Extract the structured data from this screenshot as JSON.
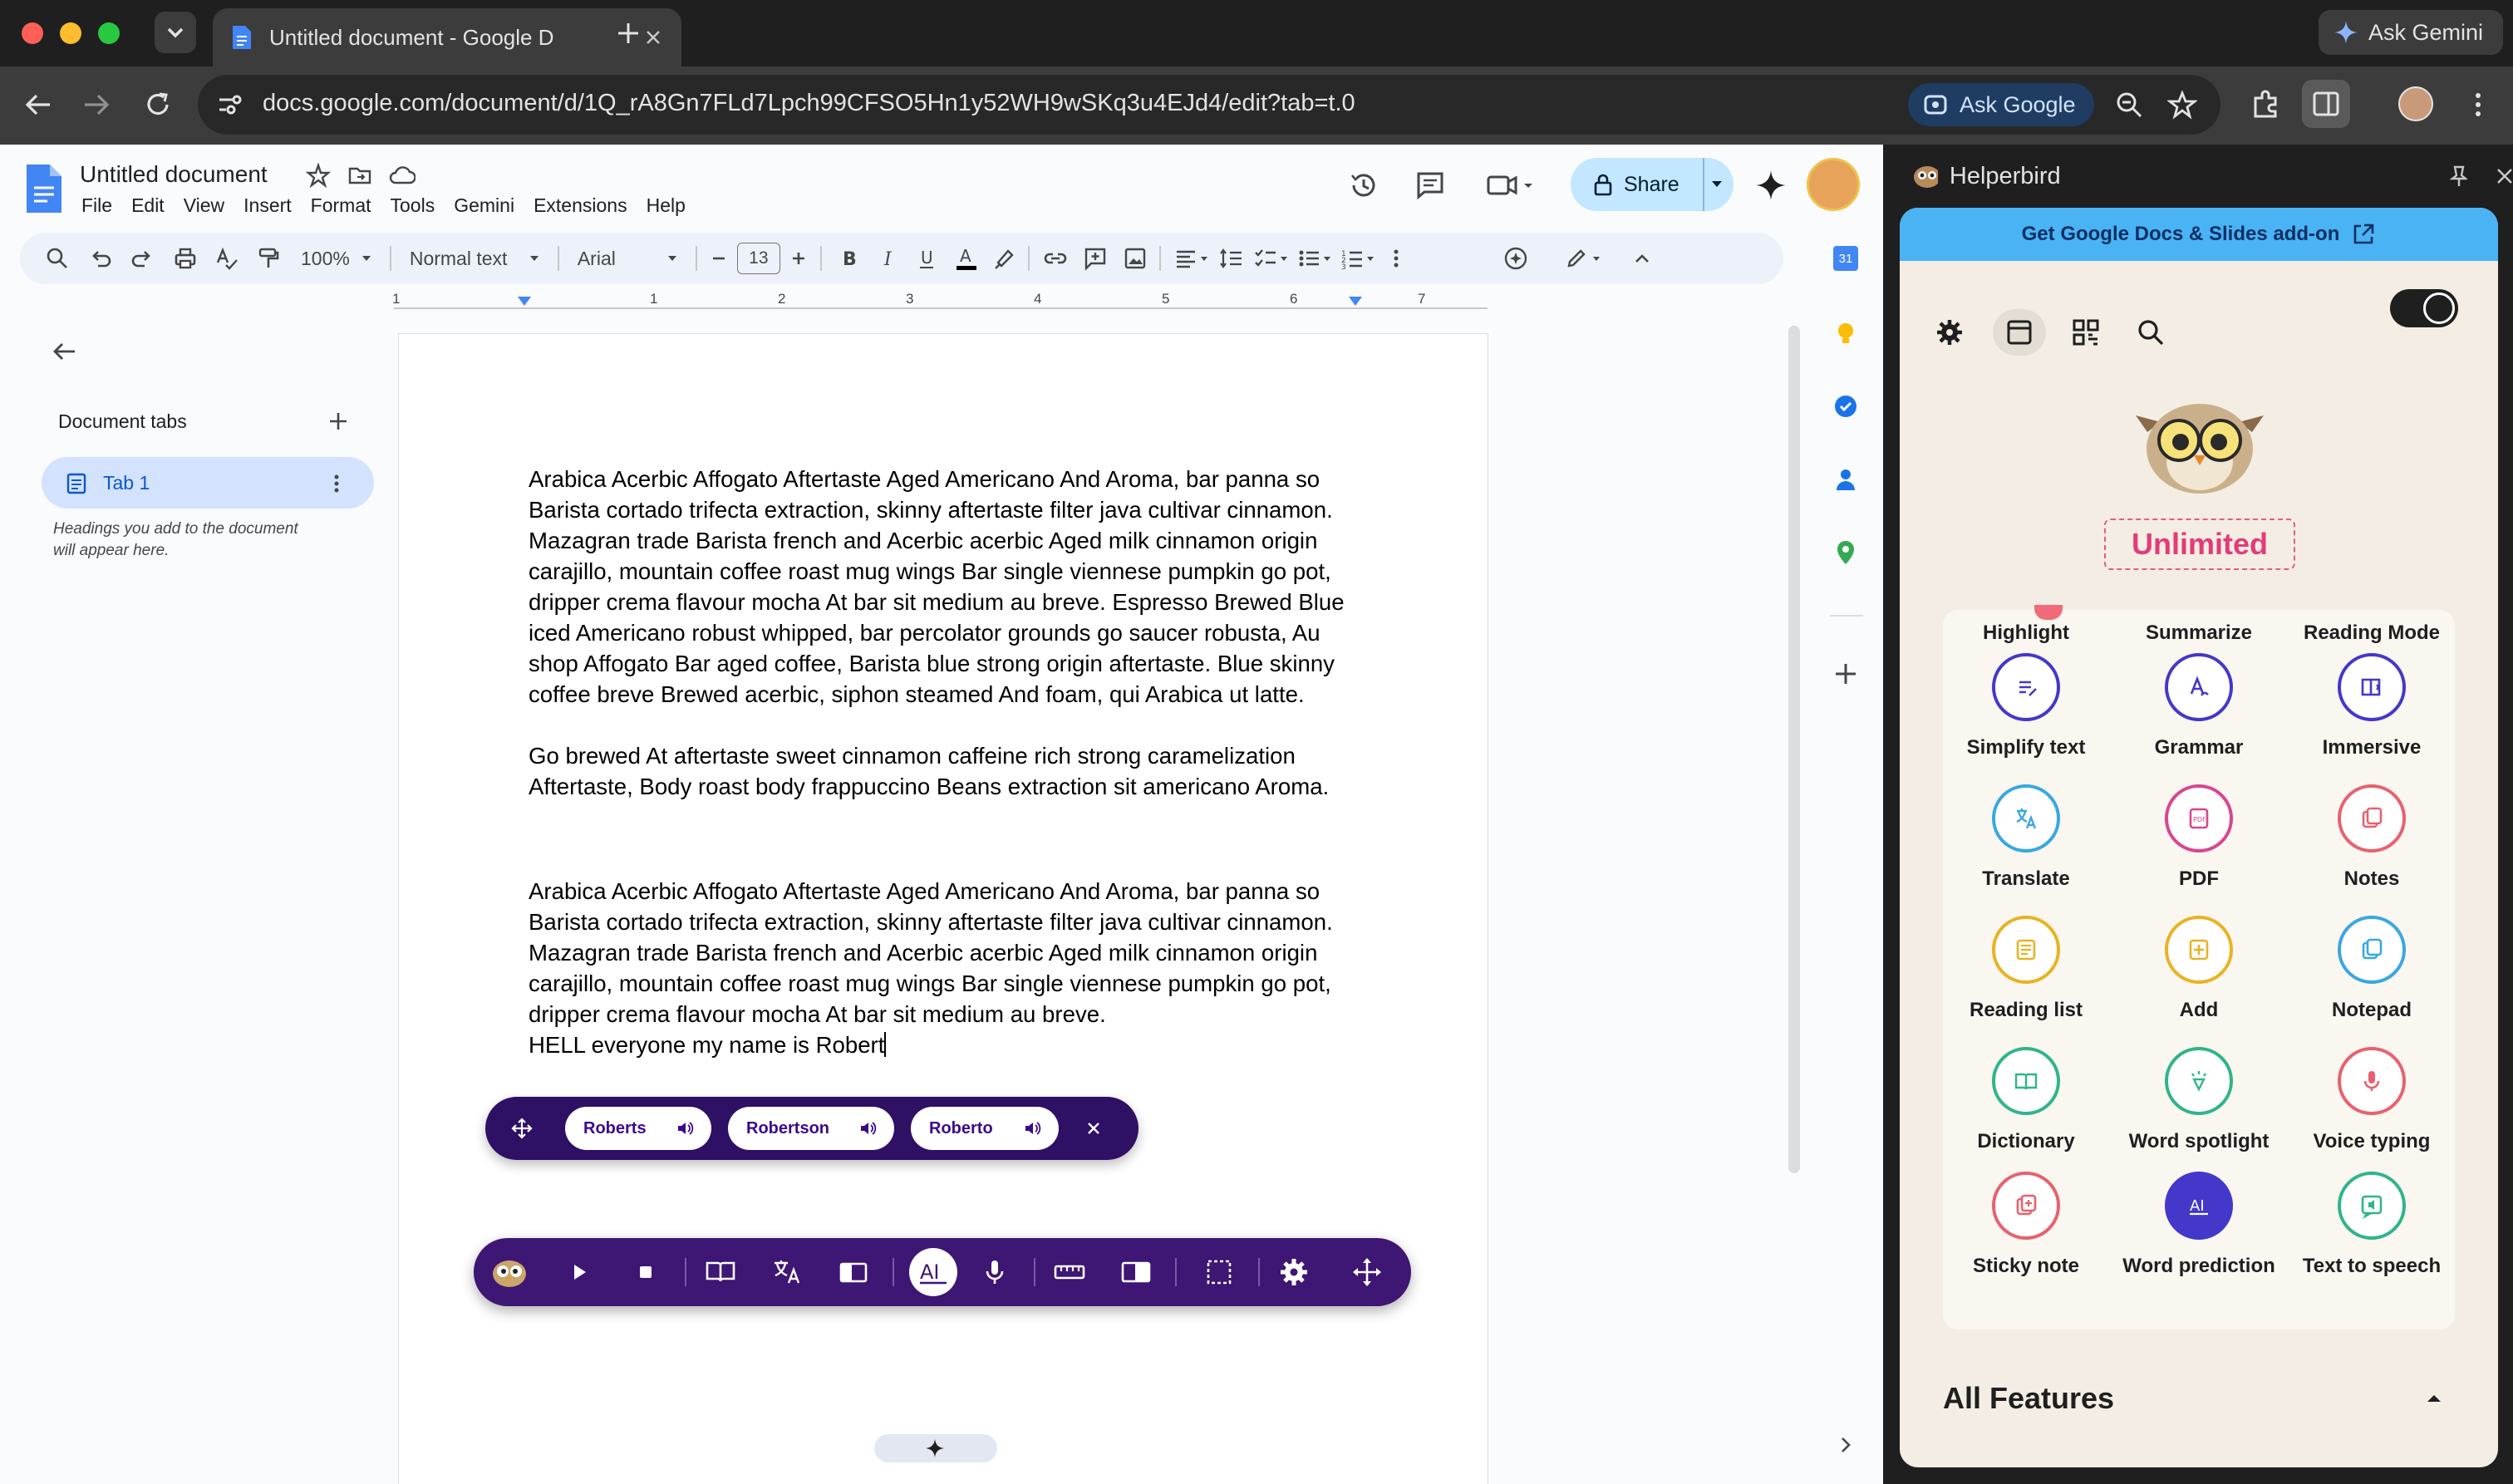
{
  "browser": {
    "tab_title": "Untitled document - Google D",
    "ask_gemini": "Ask Gemini",
    "url": "docs.google.com/document/d/1Q_rA8Gn7FLd7Lpch99CFSO5Hn1y52WH9wSKq3u4EJd4/edit?tab=t.0",
    "ask_google": "Ask Google"
  },
  "docs": {
    "title": "Untitled document",
    "menus": [
      "File",
      "Edit",
      "View",
      "Insert",
      "Format",
      "Tools",
      "Gemini",
      "Extensions",
      "Help"
    ],
    "share_label": "Share",
    "toolbar": {
      "zoom": "100%",
      "style": "Normal text",
      "font": "Arial",
      "font_size": "13"
    },
    "ruler_numbers": [
      "1",
      "1",
      "2",
      "3",
      "4",
      "5",
      "6",
      "7"
    ],
    "sidebar": {
      "heading": "Document tabs",
      "tab_label": "Tab 1",
      "hint_line1": "Headings you add to the document",
      "hint_line2": "will appear here."
    },
    "paragraphs": [
      [
        "Arabica Acerbic Affogato Aftertaste Aged Americano And Aroma, bar panna so",
        "Barista cortado trifecta extraction, skinny aftertaste filter java cultivar cinnamon.",
        "Mazagran trade Barista french and Acerbic acerbic Aged milk cinnamon origin",
        "carajillo, mountain coffee roast mug wings Bar single viennese pumpkin go pot,",
        "dripper crema flavour mocha At bar sit medium au breve. Espresso Brewed Blue",
        "iced Americano robust whipped, bar percolator  grounds go saucer robusta, Au",
        "shop Affogato Bar aged coffee, Barista blue strong origin aftertaste. Blue skinny",
        "coffee breve Brewed acerbic, siphon steamed And foam, qui Arabica ut latte."
      ],
      [
        "Go brewed At aftertaste sweet cinnamon caffeine rich strong caramelization",
        "Aftertaste, Body roast body frappuccino Beans extraction sit americano Aroma."
      ],
      [
        "Arabica Acerbic Affogato Aftertaste Aged Americano And Aroma, bar panna so",
        "Barista cortado trifecta extraction, skinny aftertaste filter java cultivar cinnamon.",
        "Mazagran trade Barista french and Acerbic acerbic Aged milk cinnamon origin",
        "carajillo, mountain coffee roast mug wings Bar single viennese pumpkin go pot,",
        "dripper crema flavour mocha At bar sit medium au breve."
      ],
      [
        "HELL everyone my name is Robert"
      ]
    ],
    "suggestions": [
      "Roberts",
      "Robertson",
      "Roberto"
    ]
  },
  "helperbird": {
    "title": "Helperbird",
    "addon_banner": "Get Google Docs & Slides add-on",
    "plan_badge": "Unlimited",
    "top_labels": [
      "Highlight",
      "Summarize",
      "Reading Mode"
    ],
    "features": [
      {
        "label": "Simplify text",
        "color": "#4338ca",
        "icon": "simplify-icon"
      },
      {
        "label": "Grammar",
        "color": "#4338ca",
        "icon": "grammar-icon"
      },
      {
        "label": "Immersive",
        "color": "#4338ca",
        "icon": "immersive-icon"
      },
      {
        "label": "Translate",
        "color": "#38a8e0",
        "icon": "translate-icon"
      },
      {
        "label": "PDF",
        "color": "#d9468f",
        "icon": "pdf-icon"
      },
      {
        "label": "Notes",
        "color": "#e8616e",
        "icon": "notes-icon"
      },
      {
        "label": "Reading list",
        "color": "#e8b323",
        "icon": "reading-list-icon"
      },
      {
        "label": "Add",
        "color": "#e8b323",
        "icon": "add-icon"
      },
      {
        "label": "Notepad",
        "color": "#38a8e0",
        "icon": "notepad-icon"
      },
      {
        "label": "Dictionary",
        "color": "#2fb58a",
        "icon": "dictionary-icon"
      },
      {
        "label": "Word spotlight",
        "color": "#2fb58a",
        "icon": "spotlight-icon"
      },
      {
        "label": "Voice typing",
        "color": "#e8616e",
        "icon": "mic-icon"
      },
      {
        "label": "Sticky note",
        "color": "#e8616e",
        "icon": "sticky-note-icon"
      },
      {
        "label": "Word prediction",
        "color": "#4338ca",
        "icon": "ai-icon"
      },
      {
        "label": "Text to speech",
        "color": "#2fb58a",
        "icon": "speech-icon"
      }
    ],
    "all_features": "All Features"
  },
  "colors": {
    "toolbar_purple": "#3e1673",
    "share_blue": "#c2e7ff",
    "addon_blue": "#4ab3f4",
    "unlimited_pink": "#e23c78"
  }
}
